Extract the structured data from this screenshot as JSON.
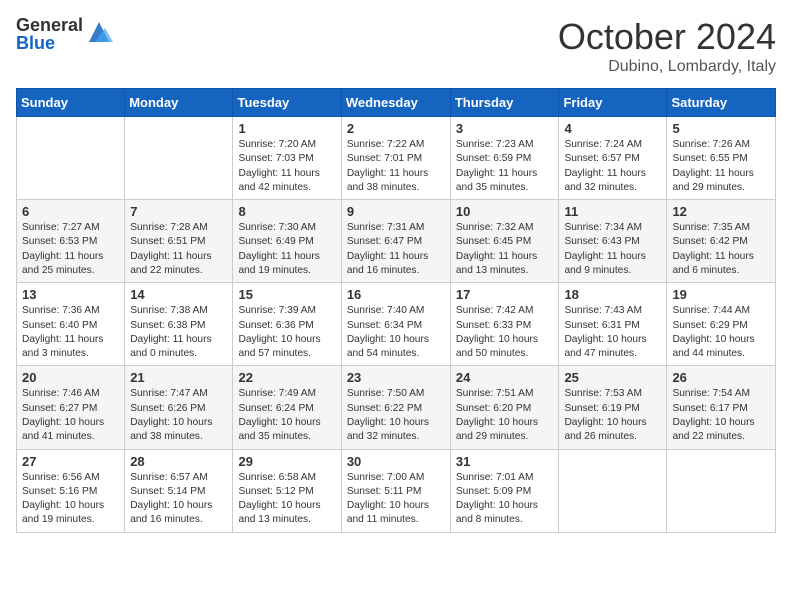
{
  "header": {
    "logo_general": "General",
    "logo_blue": "Blue",
    "month_title": "October 2024",
    "location": "Dubino, Lombardy, Italy"
  },
  "weekdays": [
    "Sunday",
    "Monday",
    "Tuesday",
    "Wednesday",
    "Thursday",
    "Friday",
    "Saturday"
  ],
  "weeks": [
    [
      {
        "day": "",
        "content": ""
      },
      {
        "day": "",
        "content": ""
      },
      {
        "day": "1",
        "content": "Sunrise: 7:20 AM\nSunset: 7:03 PM\nDaylight: 11 hours and 42 minutes."
      },
      {
        "day": "2",
        "content": "Sunrise: 7:22 AM\nSunset: 7:01 PM\nDaylight: 11 hours and 38 minutes."
      },
      {
        "day": "3",
        "content": "Sunrise: 7:23 AM\nSunset: 6:59 PM\nDaylight: 11 hours and 35 minutes."
      },
      {
        "day": "4",
        "content": "Sunrise: 7:24 AM\nSunset: 6:57 PM\nDaylight: 11 hours and 32 minutes."
      },
      {
        "day": "5",
        "content": "Sunrise: 7:26 AM\nSunset: 6:55 PM\nDaylight: 11 hours and 29 minutes."
      }
    ],
    [
      {
        "day": "6",
        "content": "Sunrise: 7:27 AM\nSunset: 6:53 PM\nDaylight: 11 hours and 25 minutes."
      },
      {
        "day": "7",
        "content": "Sunrise: 7:28 AM\nSunset: 6:51 PM\nDaylight: 11 hours and 22 minutes."
      },
      {
        "day": "8",
        "content": "Sunrise: 7:30 AM\nSunset: 6:49 PM\nDaylight: 11 hours and 19 minutes."
      },
      {
        "day": "9",
        "content": "Sunrise: 7:31 AM\nSunset: 6:47 PM\nDaylight: 11 hours and 16 minutes."
      },
      {
        "day": "10",
        "content": "Sunrise: 7:32 AM\nSunset: 6:45 PM\nDaylight: 11 hours and 13 minutes."
      },
      {
        "day": "11",
        "content": "Sunrise: 7:34 AM\nSunset: 6:43 PM\nDaylight: 11 hours and 9 minutes."
      },
      {
        "day": "12",
        "content": "Sunrise: 7:35 AM\nSunset: 6:42 PM\nDaylight: 11 hours and 6 minutes."
      }
    ],
    [
      {
        "day": "13",
        "content": "Sunrise: 7:36 AM\nSunset: 6:40 PM\nDaylight: 11 hours and 3 minutes."
      },
      {
        "day": "14",
        "content": "Sunrise: 7:38 AM\nSunset: 6:38 PM\nDaylight: 11 hours and 0 minutes."
      },
      {
        "day": "15",
        "content": "Sunrise: 7:39 AM\nSunset: 6:36 PM\nDaylight: 10 hours and 57 minutes."
      },
      {
        "day": "16",
        "content": "Sunrise: 7:40 AM\nSunset: 6:34 PM\nDaylight: 10 hours and 54 minutes."
      },
      {
        "day": "17",
        "content": "Sunrise: 7:42 AM\nSunset: 6:33 PM\nDaylight: 10 hours and 50 minutes."
      },
      {
        "day": "18",
        "content": "Sunrise: 7:43 AM\nSunset: 6:31 PM\nDaylight: 10 hours and 47 minutes."
      },
      {
        "day": "19",
        "content": "Sunrise: 7:44 AM\nSunset: 6:29 PM\nDaylight: 10 hours and 44 minutes."
      }
    ],
    [
      {
        "day": "20",
        "content": "Sunrise: 7:46 AM\nSunset: 6:27 PM\nDaylight: 10 hours and 41 minutes."
      },
      {
        "day": "21",
        "content": "Sunrise: 7:47 AM\nSunset: 6:26 PM\nDaylight: 10 hours and 38 minutes."
      },
      {
        "day": "22",
        "content": "Sunrise: 7:49 AM\nSunset: 6:24 PM\nDaylight: 10 hours and 35 minutes."
      },
      {
        "day": "23",
        "content": "Sunrise: 7:50 AM\nSunset: 6:22 PM\nDaylight: 10 hours and 32 minutes."
      },
      {
        "day": "24",
        "content": "Sunrise: 7:51 AM\nSunset: 6:20 PM\nDaylight: 10 hours and 29 minutes."
      },
      {
        "day": "25",
        "content": "Sunrise: 7:53 AM\nSunset: 6:19 PM\nDaylight: 10 hours and 26 minutes."
      },
      {
        "day": "26",
        "content": "Sunrise: 7:54 AM\nSunset: 6:17 PM\nDaylight: 10 hours and 22 minutes."
      }
    ],
    [
      {
        "day": "27",
        "content": "Sunrise: 6:56 AM\nSunset: 5:16 PM\nDaylight: 10 hours and 19 minutes."
      },
      {
        "day": "28",
        "content": "Sunrise: 6:57 AM\nSunset: 5:14 PM\nDaylight: 10 hours and 16 minutes."
      },
      {
        "day": "29",
        "content": "Sunrise: 6:58 AM\nSunset: 5:12 PM\nDaylight: 10 hours and 13 minutes."
      },
      {
        "day": "30",
        "content": "Sunrise: 7:00 AM\nSunset: 5:11 PM\nDaylight: 10 hours and 11 minutes."
      },
      {
        "day": "31",
        "content": "Sunrise: 7:01 AM\nSunset: 5:09 PM\nDaylight: 10 hours and 8 minutes."
      },
      {
        "day": "",
        "content": ""
      },
      {
        "day": "",
        "content": ""
      }
    ]
  ]
}
